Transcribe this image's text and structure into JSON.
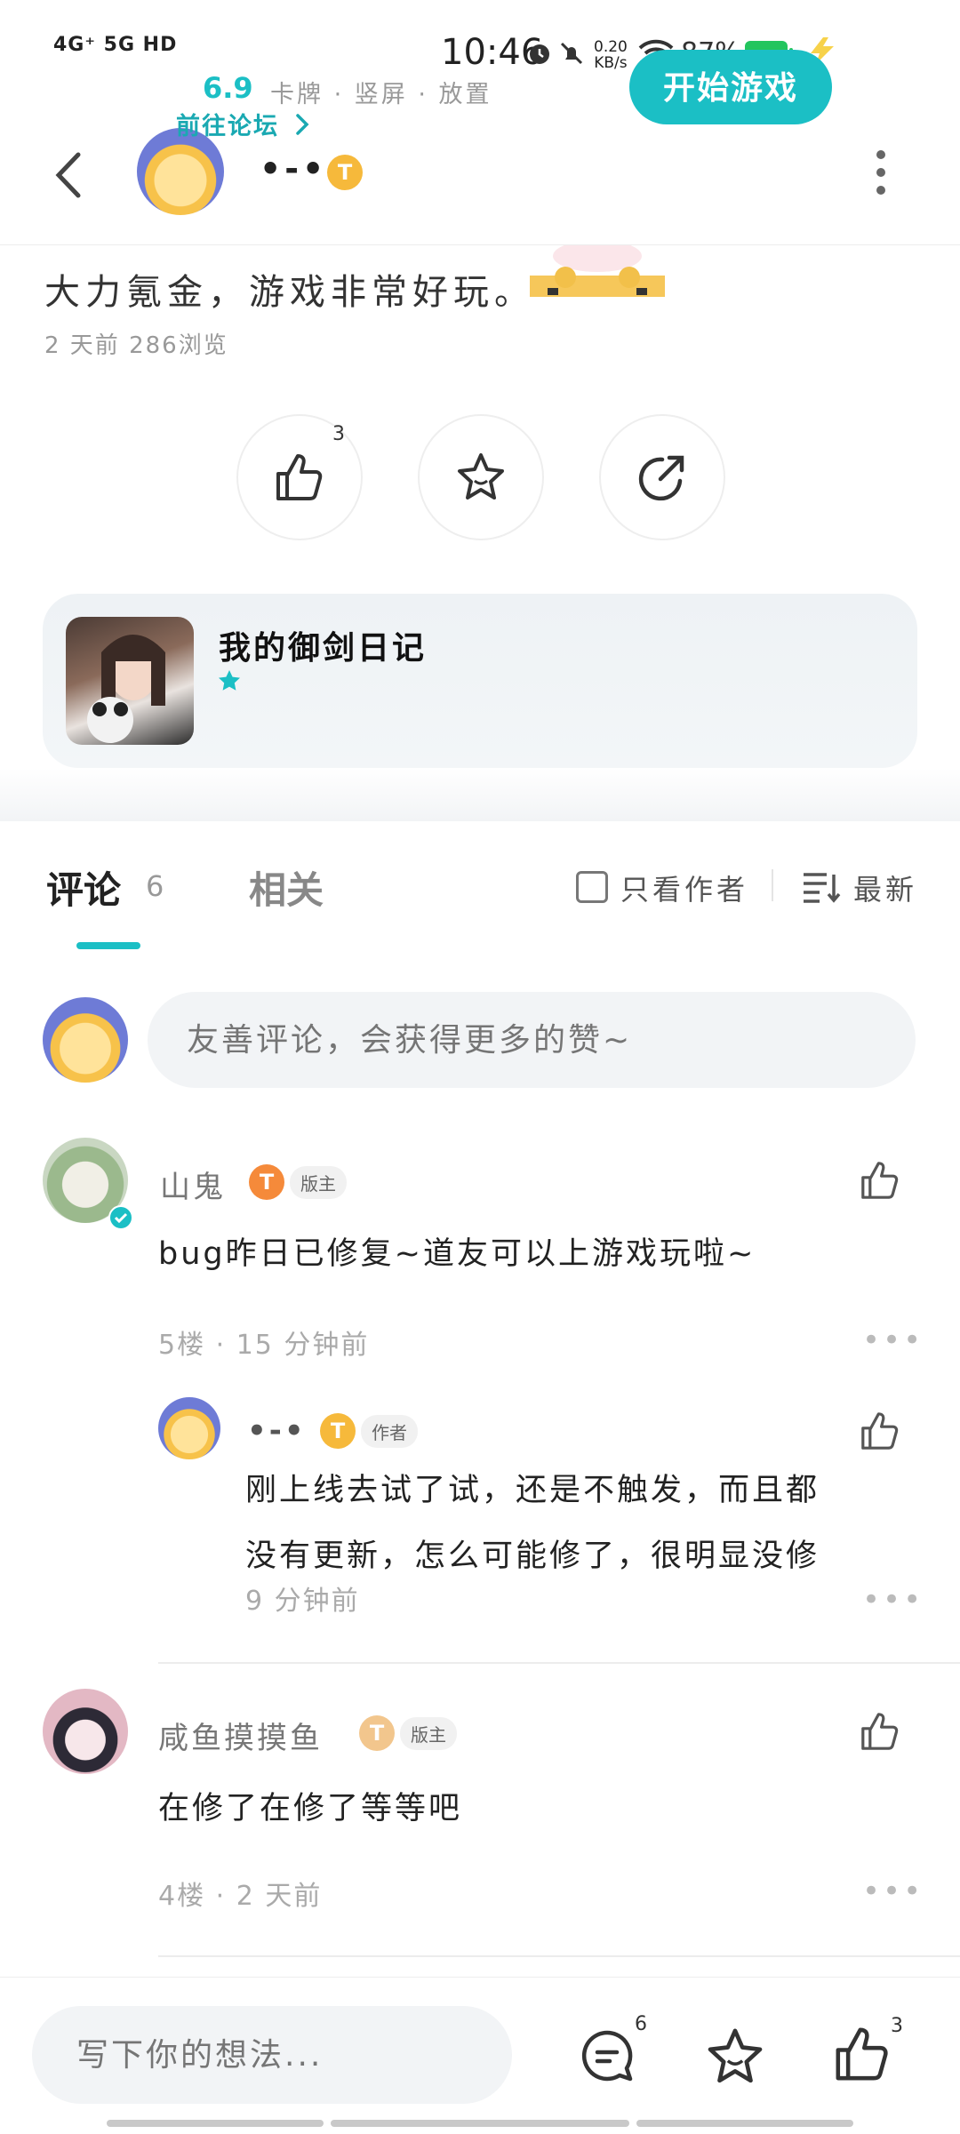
{
  "status_bar": {
    "network": "4G⁺ 5G HD",
    "time": "10:46",
    "net_speed_value": "0.20",
    "net_speed_unit": "KB/s",
    "battery": "87%"
  },
  "header": {
    "username": "•-•",
    "level_badge": "T"
  },
  "post": {
    "text": "大力氪金，游戏非常好玩。",
    "meta": "2 天前  286浏览",
    "like_count": "3"
  },
  "game_card": {
    "title": "我的御剑日记",
    "rating": "6.9",
    "tags": "卡牌 · 竖屏 · 放置",
    "forum_link": "前往论坛",
    "start_button": "开始游戏"
  },
  "tabs": {
    "comments_label": "评论",
    "comments_count": "6",
    "related_label": "相关",
    "only_author": "只看作者",
    "sort_label": "最新"
  },
  "comment_input": {
    "placeholder": "友善评论，会获得更多的赞~"
  },
  "comments": [
    {
      "name": "山鬼",
      "badge": "T",
      "tag": "版主",
      "text": "bug昨日已修复~道友可以上游戏玩啦~",
      "meta": "5楼 · 15 分钟前",
      "reply": {
        "name": "•-•",
        "badge": "T",
        "tag": "作者",
        "text_line1": "刚上线去试了试，还是不触发，而且都",
        "text_line2": "没有更新，怎么可能修了，很明显没修",
        "meta": "9 分钟前"
      }
    },
    {
      "name": "咸鱼摸摸鱼",
      "badge": "T",
      "tag": "版主",
      "text": "在修了在修了等等吧",
      "meta": "4楼 · 2 天前"
    }
  ],
  "bottom_bar": {
    "placeholder": "写下你的想法...",
    "comment_count": "6",
    "like_count": "3"
  },
  "colors": {
    "accent": "#1bbfc5",
    "badge_gold": "#f6b93b",
    "battery": "#22c55e"
  }
}
